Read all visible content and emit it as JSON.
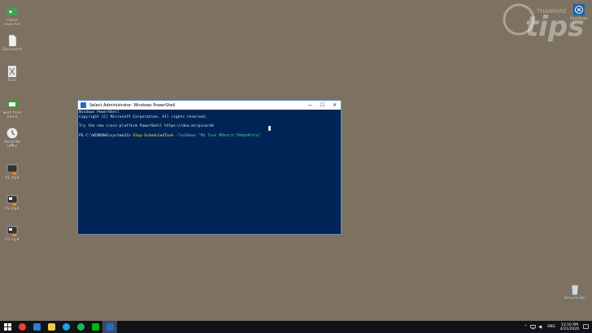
{
  "desktop": {
    "icons": [
      {
        "label": "Game Launcher",
        "color": "#3fa34d"
      },
      {
        "label": "Document",
        "color": "#e8e8e8"
      },
      {
        "label": "Tools",
        "color": "#cfcfcf"
      },
      {
        "label": "work from home",
        "color": "#3c9a3c"
      },
      {
        "label": "ตั้งเวลาปิดเครื่อง",
        "color": "#e0e0e0"
      },
      {
        "label": "01.mp4",
        "color": "#444"
      },
      {
        "label": "02.mp4",
        "color": "#444"
      },
      {
        "label": "03.mp4",
        "color": "#444"
      }
    ],
    "recycle_bin": "Recycle Bin",
    "top_right_icon": "Shutdown",
    "watermark": {
      "brand": "THAIWARE",
      "text": "tips"
    }
  },
  "window": {
    "title": "Select Administrator: Windows PowerShell",
    "controls": {
      "minimize": "—",
      "maximize": "☐",
      "close": "✕"
    },
    "console": {
      "line1": "Windows PowerShell",
      "line2": "Copyright (C) Microsoft Corporation. All rights reserved.",
      "line3": "Try the new cross-platform PowerShell https://aka.ms/pscore6",
      "prompt": "PS C:\\WINDOWS\\system32> ",
      "command": "Stop-ScheduledTask",
      "param": " -TaskName ",
      "value": "\"ชื่อ Task ที่ต้องการ ให้หยุดทำงาน\""
    }
  },
  "taskbar": {
    "apps": [
      {
        "name": "start",
        "color": "#ffffff"
      },
      {
        "name": "chrome",
        "color": "#e94235"
      },
      {
        "name": "photos",
        "color": "#2f7fd6"
      },
      {
        "name": "explorer",
        "color": "#f2c94c"
      },
      {
        "name": "skype",
        "color": "#1aa3e8"
      },
      {
        "name": "spotify",
        "color": "#1db954"
      },
      {
        "name": "line",
        "color": "#00b900"
      },
      {
        "name": "powershell",
        "color": "#2a68c8"
      }
    ],
    "tray": {
      "lang": "ENG",
      "time": "12:10 PM",
      "date": "4/21/2020"
    }
  }
}
